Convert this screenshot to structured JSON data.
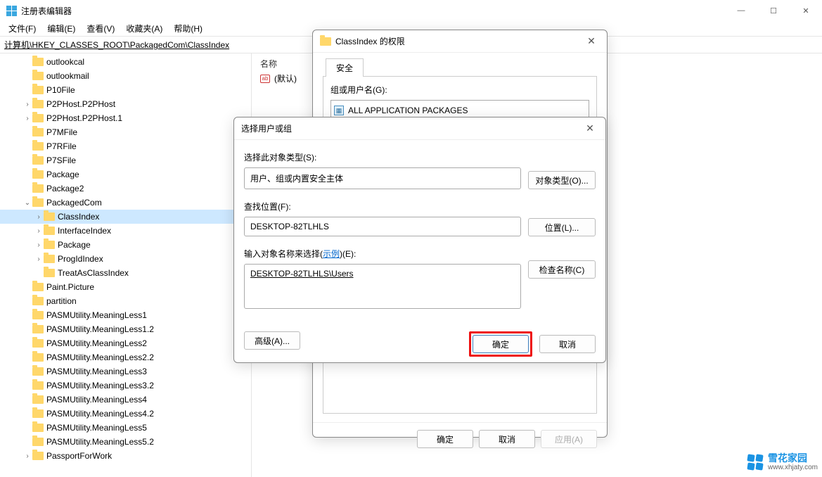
{
  "window": {
    "title": "注册表编辑器",
    "minimize": "—",
    "maximize": "☐",
    "close": "✕"
  },
  "menu": {
    "file": "文件(F)",
    "edit": "编辑(E)",
    "view": "查看(V)",
    "favorites": "收藏夹(A)",
    "help": "帮助(H)"
  },
  "address": "计算机\\HKEY_CLASSES_ROOT\\PackagedCom\\ClassIndex",
  "tree": [
    {
      "indent": 2,
      "expand": "",
      "label": "outlookcal"
    },
    {
      "indent": 2,
      "expand": "",
      "label": "outlookmail"
    },
    {
      "indent": 2,
      "expand": "",
      "label": "P10File"
    },
    {
      "indent": 2,
      "expand": ">",
      "label": "P2PHost.P2PHost"
    },
    {
      "indent": 2,
      "expand": ">",
      "label": "P2PHost.P2PHost.1"
    },
    {
      "indent": 2,
      "expand": "",
      "label": "P7MFile"
    },
    {
      "indent": 2,
      "expand": "",
      "label": "P7RFile"
    },
    {
      "indent": 2,
      "expand": "",
      "label": "P7SFile"
    },
    {
      "indent": 2,
      "expand": "",
      "label": "Package"
    },
    {
      "indent": 2,
      "expand": "",
      "label": "Package2"
    },
    {
      "indent": 2,
      "expand": "v",
      "label": "PackagedCom"
    },
    {
      "indent": 3,
      "expand": ">",
      "label": "ClassIndex",
      "selected": true
    },
    {
      "indent": 3,
      "expand": ">",
      "label": "InterfaceIndex"
    },
    {
      "indent": 3,
      "expand": ">",
      "label": "Package"
    },
    {
      "indent": 3,
      "expand": ">",
      "label": "ProgIdIndex"
    },
    {
      "indent": 3,
      "expand": "",
      "label": "TreatAsClassIndex"
    },
    {
      "indent": 2,
      "expand": "",
      "label": "Paint.Picture"
    },
    {
      "indent": 2,
      "expand": "",
      "label": "partition"
    },
    {
      "indent": 2,
      "expand": "",
      "label": "PASMUtility.MeaningLess1"
    },
    {
      "indent": 2,
      "expand": "",
      "label": "PASMUtility.MeaningLess1.2"
    },
    {
      "indent": 2,
      "expand": "",
      "label": "PASMUtility.MeaningLess2"
    },
    {
      "indent": 2,
      "expand": "",
      "label": "PASMUtility.MeaningLess2.2"
    },
    {
      "indent": 2,
      "expand": "",
      "label": "PASMUtility.MeaningLess3"
    },
    {
      "indent": 2,
      "expand": "",
      "label": "PASMUtility.MeaningLess3.2"
    },
    {
      "indent": 2,
      "expand": "",
      "label": "PASMUtility.MeaningLess4"
    },
    {
      "indent": 2,
      "expand": "",
      "label": "PASMUtility.MeaningLess4.2"
    },
    {
      "indent": 2,
      "expand": "",
      "label": "PASMUtility.MeaningLess5"
    },
    {
      "indent": 2,
      "expand": "",
      "label": "PASMUtility.MeaningLess5.2"
    },
    {
      "indent": 2,
      "expand": ">",
      "label": "PassportForWork"
    }
  ],
  "list": {
    "header_name": "名称",
    "default_row": "(默认)",
    "str_icon": "ab"
  },
  "perm_dialog": {
    "title": "ClassIndex 的权限",
    "tab": "安全",
    "group_label": "组或用户名(G):",
    "group_item": "ALL APPLICATION PACKAGES",
    "ok": "确定",
    "cancel": "取消",
    "apply": "应用(A)"
  },
  "select_dialog": {
    "title": "选择用户或组",
    "type_label": "选择此对象类型(S):",
    "type_value": "用户、组或内置安全主体",
    "type_btn": "对象类型(O)...",
    "loc_label": "查找位置(F):",
    "loc_value": "DESKTOP-82TLHLS",
    "loc_btn": "位置(L)...",
    "name_label_prefix": "输入对象名称来选择(",
    "name_label_link": "示例",
    "name_label_suffix": ")(E):",
    "name_value": "DESKTOP-82TLHLS\\Users",
    "check_btn": "检查名称(C)",
    "advanced": "高级(A)...",
    "ok": "确定",
    "cancel": "取消"
  },
  "watermark": {
    "cn": "雪花家园",
    "url": "www.xhjaty.com"
  }
}
